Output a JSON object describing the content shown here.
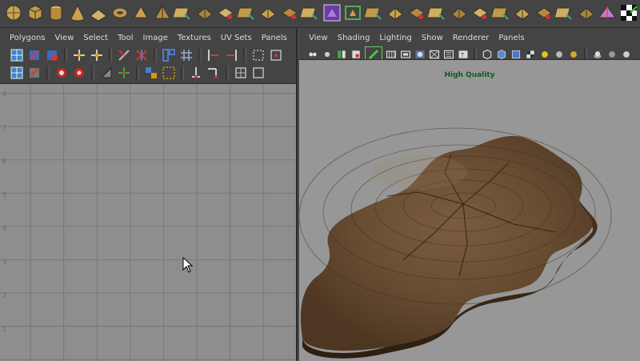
{
  "shelf": {
    "icons": [
      "sphere-icon",
      "cube-icon",
      "cylinder-icon",
      "cone-icon",
      "plane-icon",
      "torus-icon",
      "prism-icon",
      "pyramid-icon",
      "pipe-icon",
      "helix-icon",
      "soccer-ball-icon",
      "platonic-solid-icon",
      "combine-icon",
      "separate-icon",
      "extract-icon",
      "smooth-icon",
      "booleans-icon",
      "reduce-icon",
      "cleanup-icon",
      "triangulate-icon",
      "quadrangulate-icon",
      "fill-hole-icon",
      "make-hole-icon",
      "create-polygon-icon",
      "append-polygon-icon",
      "split-polygon-icon",
      "extrude-icon",
      "bridge-icon",
      "mirror-icon",
      "checker-icon"
    ]
  },
  "uv_editor": {
    "menus": [
      "Polygons",
      "View",
      "Select",
      "Tool",
      "Image",
      "Textures",
      "UV Sets",
      "Panels"
    ],
    "ticks": [
      "8",
      "7",
      "6",
      "5",
      "4",
      "3",
      "2",
      "1"
    ]
  },
  "viewport": {
    "menus": [
      "View",
      "Shading",
      "Lighting",
      "Show",
      "Renderer",
      "Panels"
    ],
    "label": "High Quality"
  },
  "colors": {
    "ui_bg": "#444444",
    "uv_grid_bg": "#8e8e8e",
    "viewport_bg": "#979797",
    "hq_label": "#0e5b17",
    "wood_top": "#6b5037",
    "wood_edge": "#3f2b19"
  }
}
